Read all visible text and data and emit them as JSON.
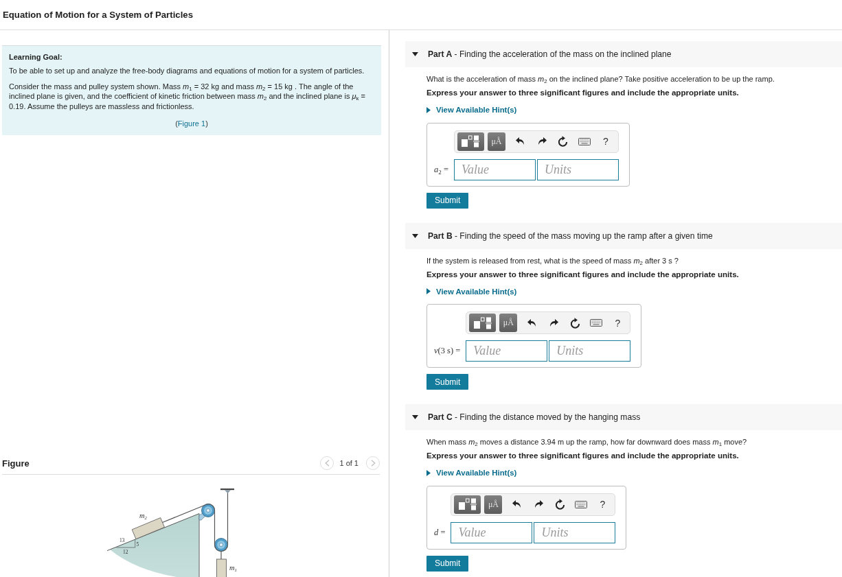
{
  "title": "Equation of Motion for a System of Particles",
  "learning_goal": {
    "heading": "Learning Goal:",
    "paragraphs": [
      "To be able to set up and analyze the free-body diagrams and equations of motion for a system of particles.",
      "Consider the mass and pulley system shown. Mass *m*$_{1}$ = 32 kg and mass *m*$_{2}$ = 15 kg . The angle of the inclined plane is given, and the coefficient of kinetic friction between mass *m*$_{2}$ and the inclined plane is *μ*$_{k}$ = 0.19. Assume the pulleys are massless and frictionless."
    ],
    "figure_reference": {
      "prefix": "(",
      "link": "Figure 1",
      "suffix": ")"
    }
  },
  "figure": {
    "heading": "Figure",
    "pager": {
      "previous": {
        "disabled": true
      },
      "position": "1 of 1",
      "next": {
        "disabled": true
      }
    },
    "labels": [
      {
        "kind": "mass",
        "symbol": "m",
        "subscript": "2"
      },
      {
        "kind": "dimension",
        "text": "13"
      },
      {
        "kind": "dimension",
        "text": "5"
      },
      {
        "kind": "dimension",
        "text": "12"
      },
      {
        "kind": "mass",
        "symbol": "m",
        "subscript": "1"
      }
    ]
  },
  "parts": [
    {
      "header": "**Part A** - Finding the acceleration of the mass on the inclined plane",
      "expanded": true,
      "question": "What is the acceleration of mass *m*$_{2}$ on the inclined plane? Take positive acceleration to be up the ramp.",
      "instruction": "Express your answer to three significant figures and include the appropriate units.",
      "hint_link": "View Available Hint(s)",
      "toolbar": [
        {
          "kind": "templates"
        },
        {
          "kind": "units",
          "label": "μÅ"
        },
        {
          "kind": "undo"
        },
        {
          "kind": "redo"
        },
        {
          "kind": "reset"
        },
        {
          "kind": "keyboard"
        },
        {
          "kind": "help",
          "label": "?"
        }
      ],
      "answer_label": "*a*$_{2}$ =",
      "inputs": [
        {
          "placeholder": "Value"
        },
        {
          "placeholder": "Units"
        }
      ],
      "submit": "Submit"
    },
    {
      "header": "**Part B** - Finding the speed of the mass moving up the ramp after a given time",
      "expanded": true,
      "question": "If the system is released from rest, what is the speed of mass *m*$_{2}$ after 3 s ?",
      "instruction": "Express your answer to three significant figures and include the appropriate units.",
      "hint_link": "View Available Hint(s)",
      "toolbar": [
        {
          "kind": "templates"
        },
        {
          "kind": "units",
          "label": "μÅ"
        },
        {
          "kind": "undo"
        },
        {
          "kind": "redo"
        },
        {
          "kind": "reset"
        },
        {
          "kind": "keyboard"
        },
        {
          "kind": "help",
          "label": "?"
        }
      ],
      "answer_label": "*v*(3 s) =",
      "inputs": [
        {
          "placeholder": "Value"
        },
        {
          "placeholder": "Units"
        }
      ],
      "submit": "Submit"
    },
    {
      "header": "**Part C** - Finding the distance moved by the hanging mass",
      "expanded": true,
      "question": "When mass *m*$_{2}$ moves a distance 3.94 m up the ramp, how far downward does mass *m*$_{1}$ move?",
      "instruction": "Express your answer to three significant figures and include the appropriate units.",
      "hint_link": "View Available Hint(s)",
      "toolbar": [
        {
          "kind": "templates"
        },
        {
          "kind": "units",
          "label": "μÅ"
        },
        {
          "kind": "undo"
        },
        {
          "kind": "redo"
        },
        {
          "kind": "reset"
        },
        {
          "kind": "keyboard"
        },
        {
          "kind": "help",
          "label": "?"
        }
      ],
      "answer_label": "*d* =",
      "inputs": [
        {
          "placeholder": "Value"
        },
        {
          "placeholder": "Units"
        }
      ],
      "submit": "Submit"
    }
  ]
}
